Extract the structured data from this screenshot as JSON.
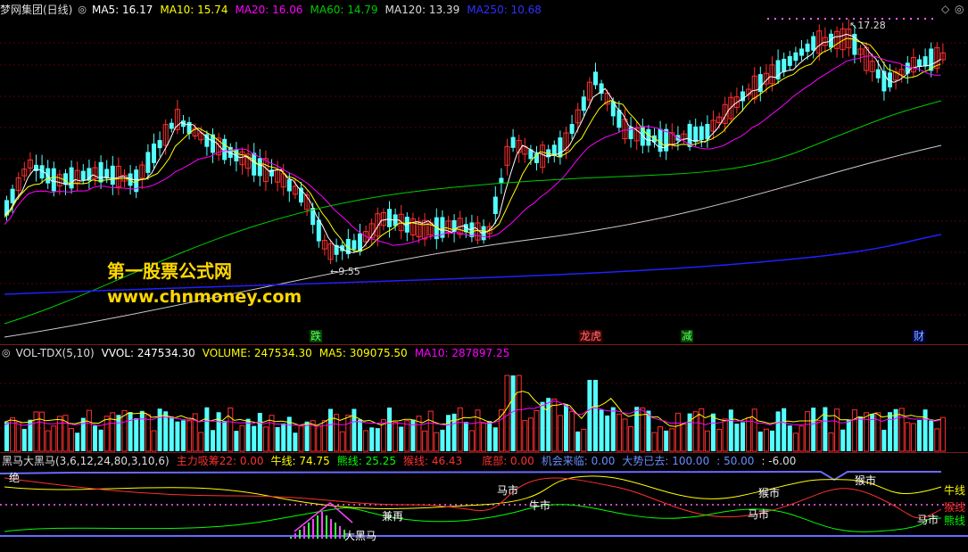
{
  "main_header": {
    "name": "梦网集团(日线)",
    "ma5": "MA5: 16.17",
    "ma10": "MA10: 15.74",
    "ma20": "MA20: 16.06",
    "ma60": "MA60: 14.79",
    "ma120": "MA120: 13.39",
    "ma250": "MA250: 10.68"
  },
  "annotations": {
    "high": "17.28",
    "low": "9.55"
  },
  "watermark": {
    "line1": "第一股票公式网",
    "line2": "www.chnmoney.com"
  },
  "events": [
    "跌",
    "龙虎",
    "减",
    "财"
  ],
  "vol_header": {
    "name": "VOL-TDX(5,10)",
    "vvol": "VVOL: 247534.30",
    "volume": "VOLUME: 247534.30",
    "ma5": "MA5: 309075.50",
    "ma10": "MA10: 287897.25"
  },
  "ind_header": {
    "name": "黑马大黑马(3,6,12,24,80,3,10,6)",
    "zlxc": "主力吸筹22: 0.00",
    "niu": "牛线: 74.75",
    "xiong": "熊线: 25.25",
    "hou": "猴线: 46.43",
    "dibu": "底部: 0.00",
    "jihui": "机会来临: 0.00",
    "dashi": "大势已去: 100.00",
    "v50": ": 50.00",
    "vneg": ": -6.00"
  },
  "ind_labels": {
    "ma_shi_1": "马市",
    "niu_shi": "牛市",
    "hou_shi": "猴市",
    "hou_shi_2": "猴市",
    "ma_shi_2": "马市",
    "ma_shi_3": "马市",
    "jian_shang": "兼再",
    "da_hei_ma": "大黑马",
    "jue": "绝",
    "right_niu": "牛线",
    "right_hou": "猴线",
    "right_xiong": "熊线"
  },
  "colors": {
    "up": "#ff3030",
    "down": "#54ffff",
    "ma5": "#ffffff",
    "ma10": "#ffff00",
    "ma20": "#ff00ff",
    "ma60": "#00cc00",
    "ma120": "#cccccc",
    "ma250": "#2020ff"
  }
}
